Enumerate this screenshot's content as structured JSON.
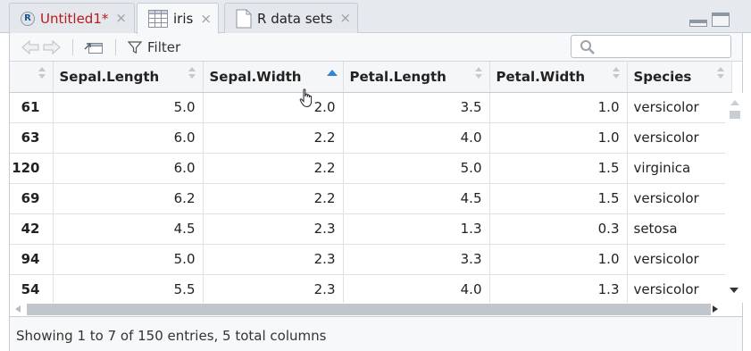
{
  "tabs": [
    {
      "label": "Untitled1*",
      "icon": "r-script-icon",
      "close": "×",
      "active": false
    },
    {
      "label": "iris",
      "icon": "data-grid-icon",
      "close": "×",
      "active": true
    },
    {
      "label": "R data sets",
      "icon": "document-icon",
      "close": "×",
      "active": false
    }
  ],
  "toolbar": {
    "filter_label": "Filter",
    "search_placeholder": "",
    "search_value": ""
  },
  "table": {
    "columns": [
      {
        "label": "",
        "sort": "none"
      },
      {
        "label": "Sepal.Length",
        "sort": "none"
      },
      {
        "label": "Sepal.Width",
        "sort": "ascending"
      },
      {
        "label": "Petal.Length",
        "sort": "none"
      },
      {
        "label": "Petal.Width",
        "sort": "none"
      },
      {
        "label": "Species",
        "sort": "none"
      }
    ],
    "rows": [
      [
        "61",
        "5.0",
        "2.0",
        "3.5",
        "1.0",
        "versicolor"
      ],
      [
        "63",
        "6.0",
        "2.2",
        "4.0",
        "1.0",
        "versicolor"
      ],
      [
        "120",
        "6.0",
        "2.2",
        "5.0",
        "1.5",
        "virginica"
      ],
      [
        "69",
        "6.2",
        "2.2",
        "4.5",
        "1.5",
        "versicolor"
      ],
      [
        "42",
        "4.5",
        "2.3",
        "1.3",
        "0.3",
        "setosa"
      ],
      [
        "94",
        "5.0",
        "2.3",
        "3.3",
        "1.0",
        "versicolor"
      ],
      [
        "54",
        "5.5",
        "2.3",
        "4.0",
        "1.3",
        "versicolor"
      ]
    ]
  },
  "status": {
    "text": "Showing 1 to 7 of 150 entries, 5 total columns"
  },
  "colors": {
    "accent": "#2f86d6",
    "modified_tab": "#b71c1c"
  }
}
